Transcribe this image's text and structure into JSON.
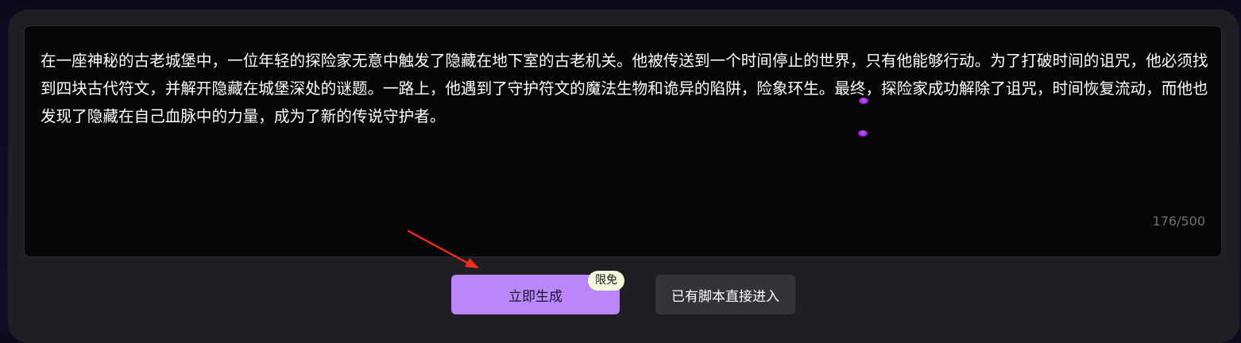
{
  "editor": {
    "text": "在一座神秘的古老城堡中，一位年轻的探险家无意中触发了隐藏在地下室的古老机关。他被传送到一个时间停止的世界，只有他能够行动。为了打破时间的诅咒，他必须找到四块古代符文，并解开隐藏在城堡深处的谜题。一路上，他遇到了守护符文的魔法生物和诡异的陷阱，险象环生。最终，探险家成功解除了诅咒，时间恢复流动，而他也发现了隐藏在自己血脉中的力量，成为了新的传说守护者。",
    "char_count": "176/500"
  },
  "actions": {
    "generate_label": "立即生成",
    "free_badge": "限免",
    "direct_enter_label": "已有脚本直接进入"
  },
  "colors": {
    "accent": "#b987f7",
    "annotation_arrow": "#ff2a1a"
  }
}
